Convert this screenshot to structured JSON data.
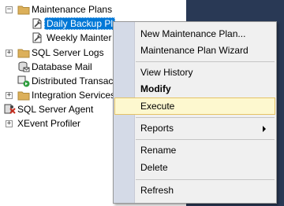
{
  "tree": {
    "maintenance_plans": "Maintenance Plans",
    "daily_backup": "Daily Backup Pl",
    "weekly_maint": "Weekly Mainter",
    "sql_server_logs": "SQL Server Logs",
    "database_mail": "Database Mail",
    "distributed_trans": "Distributed Transac",
    "integration_services": "Integration Services Ca",
    "sql_server_agent": "SQL Server Agent",
    "xevent_profiler": "XEvent Profiler"
  },
  "menu": {
    "new_plan": "New Maintenance Plan...",
    "wizard": "Maintenance Plan Wizard",
    "view_history": "View History",
    "modify": "Modify",
    "execute": "Execute",
    "reports": "Reports",
    "rename": "Rename",
    "delete": "Delete",
    "refresh": "Refresh"
  },
  "colors": {
    "selection": "#0078d7",
    "menu_hover_bg": "#fdf8cf",
    "menu_hover_border": "#e5c365",
    "dark_pane": "#293955"
  }
}
